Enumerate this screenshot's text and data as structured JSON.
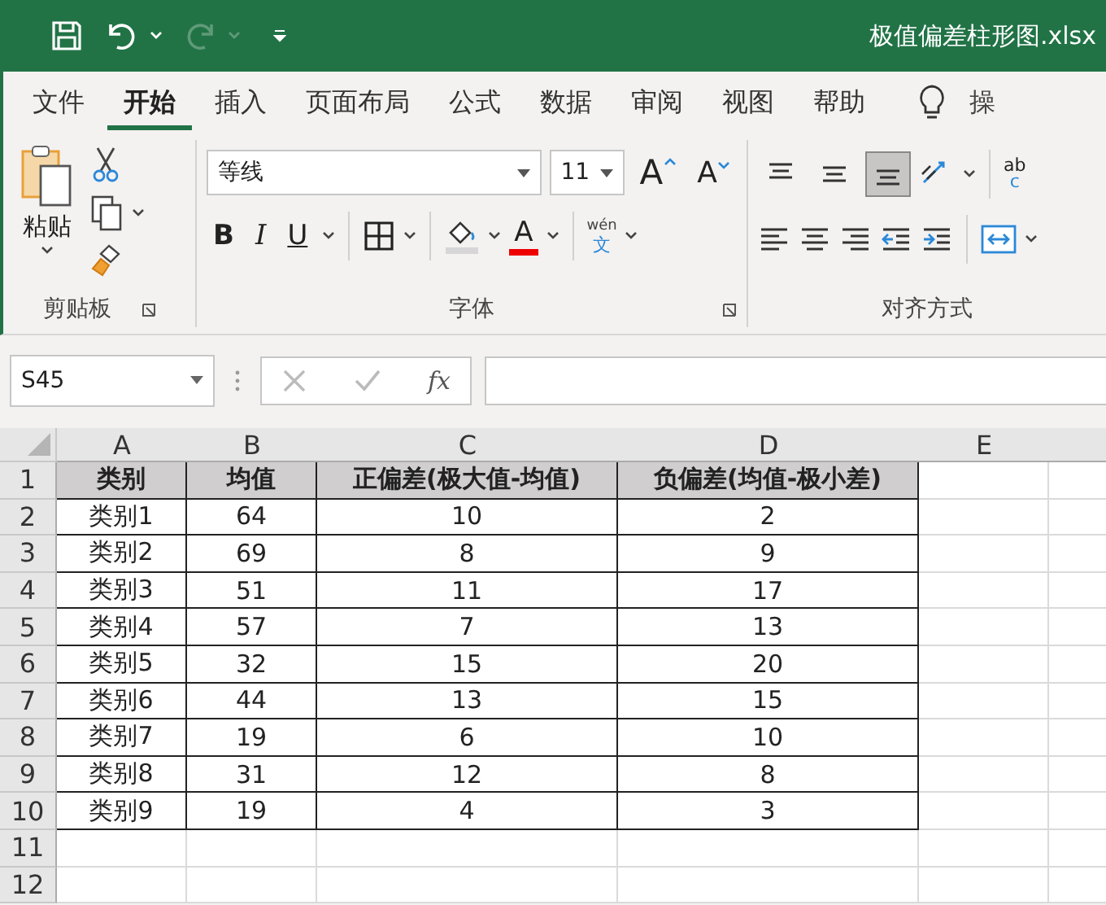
{
  "title_bar": {
    "filename": "极值偏差柱形图.xlsx",
    "redo_disabled": true
  },
  "tabs": [
    {
      "label": "文件",
      "selected": false
    },
    {
      "label": "开始",
      "selected": true
    },
    {
      "label": "插入",
      "selected": false
    },
    {
      "label": "页面布局",
      "selected": false
    },
    {
      "label": "公式",
      "selected": false
    },
    {
      "label": "数据",
      "selected": false
    },
    {
      "label": "审阅",
      "selected": false
    },
    {
      "label": "视图",
      "selected": false
    },
    {
      "label": "帮助",
      "selected": false
    }
  ],
  "tell_me": "操",
  "ribbon": {
    "clipboard": {
      "paste_label": "粘贴",
      "group_label": "剪贴板"
    },
    "font": {
      "font_name": "等线",
      "font_size": "11",
      "grow": "A",
      "shrink": "A",
      "bold": "B",
      "italic": "I",
      "underline": "U",
      "font_color": "A",
      "phonetic_top": "wén",
      "phonetic_bottom": "文",
      "group_label": "字体"
    },
    "alignment": {
      "vertical": [
        {
          "selected": false
        },
        {
          "selected": false
        },
        {
          "selected": true
        }
      ],
      "wrap_top": "ab",
      "wrap_bottom": "c",
      "group_label": "对齐方式"
    }
  },
  "formula_bar": {
    "name_box": "S45",
    "fx": "fx"
  },
  "sheet": {
    "columns": [
      "A",
      "B",
      "C",
      "D",
      "E"
    ],
    "rows": [
      {
        "number": "1",
        "kind": "header",
        "cells": [
          "类别",
          "均值",
          "正偏差(极大值-均值)",
          "负偏差(均值-极小差)"
        ]
      },
      {
        "number": "2",
        "kind": "data",
        "cells": [
          "类别1",
          "64",
          "10",
          "2"
        ]
      },
      {
        "number": "3",
        "kind": "data",
        "cells": [
          "类别2",
          "69",
          "8",
          "9"
        ]
      },
      {
        "number": "4",
        "kind": "data",
        "cells": [
          "类别3",
          "51",
          "11",
          "17"
        ]
      },
      {
        "number": "5",
        "kind": "data",
        "cells": [
          "类别4",
          "57",
          "7",
          "13"
        ]
      },
      {
        "number": "6",
        "kind": "data",
        "cells": [
          "类别5",
          "32",
          "15",
          "20"
        ]
      },
      {
        "number": "7",
        "kind": "data",
        "cells": [
          "类别6",
          "44",
          "13",
          "15"
        ]
      },
      {
        "number": "8",
        "kind": "data",
        "cells": [
          "类别7",
          "19",
          "6",
          "10"
        ]
      },
      {
        "number": "9",
        "kind": "data",
        "cells": [
          "类别8",
          "31",
          "12",
          "8"
        ]
      },
      {
        "number": "10",
        "kind": "data",
        "cells": [
          "类别9",
          "19",
          "4",
          "3"
        ]
      },
      {
        "number": "11",
        "kind": "empty",
        "cells": []
      },
      {
        "number": "12",
        "kind": "empty",
        "cells": []
      }
    ]
  }
}
